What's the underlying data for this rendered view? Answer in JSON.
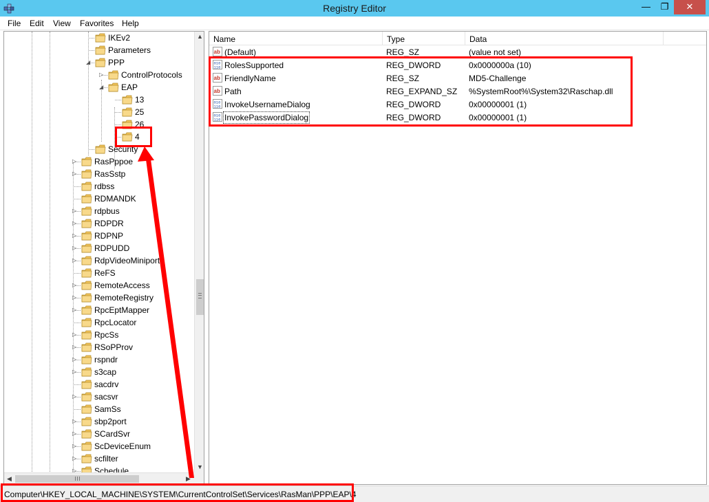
{
  "window": {
    "title": "Registry Editor",
    "minimize_glyph": "—",
    "restore_glyph": "❐",
    "close_glyph": "✕"
  },
  "menu": [
    "File",
    "Edit",
    "View",
    "Favorites",
    "Help"
  ],
  "tree": {
    "items": [
      {
        "label": "IKEv2",
        "expander": ""
      },
      {
        "label": "Parameters",
        "expander": ""
      },
      {
        "label": "PPP",
        "expander": "expanded"
      },
      {
        "label": "ControlProtocols",
        "expander": "collapsed"
      },
      {
        "label": "EAP",
        "expander": "expanded"
      },
      {
        "label": "13",
        "expander": ""
      },
      {
        "label": "25",
        "expander": ""
      },
      {
        "label": "26",
        "expander": ""
      },
      {
        "label": "4",
        "expander": "",
        "selected": true
      },
      {
        "label": "Security",
        "expander": ""
      },
      {
        "label": "RasPppoe",
        "expander": "collapsed"
      },
      {
        "label": "RasSstp",
        "expander": "collapsed"
      },
      {
        "label": "rdbss",
        "expander": ""
      },
      {
        "label": "RDMANDK",
        "expander": ""
      },
      {
        "label": "rdpbus",
        "expander": "collapsed"
      },
      {
        "label": "RDPDR",
        "expander": "collapsed"
      },
      {
        "label": "RDPNP",
        "expander": "collapsed"
      },
      {
        "label": "RDPUDD",
        "expander": "collapsed"
      },
      {
        "label": "RdpVideoMiniport",
        "expander": "collapsed"
      },
      {
        "label": "ReFS",
        "expander": ""
      },
      {
        "label": "RemoteAccess",
        "expander": "collapsed"
      },
      {
        "label": "RemoteRegistry",
        "expander": "collapsed"
      },
      {
        "label": "RpcEptMapper",
        "expander": "collapsed"
      },
      {
        "label": "RpcLocator",
        "expander": ""
      },
      {
        "label": "RpcSs",
        "expander": "collapsed"
      },
      {
        "label": "RSoPProv",
        "expander": "collapsed"
      },
      {
        "label": "rspndr",
        "expander": "collapsed"
      },
      {
        "label": "s3cap",
        "expander": "collapsed"
      },
      {
        "label": "sacdrv",
        "expander": ""
      },
      {
        "label": "sacsvr",
        "expander": "collapsed"
      },
      {
        "label": "SamSs",
        "expander": ""
      },
      {
        "label": "sbp2port",
        "expander": "collapsed"
      },
      {
        "label": "SCardSvr",
        "expander": "collapsed"
      },
      {
        "label": "ScDeviceEnum",
        "expander": "collapsed"
      },
      {
        "label": "scfilter",
        "expander": "collapsed"
      },
      {
        "label": "Schedule",
        "expander": "collapsed"
      }
    ]
  },
  "list": {
    "columns": [
      "Name",
      "Type",
      "Data"
    ],
    "rows": [
      {
        "name": "(Default)",
        "type": "REG_SZ",
        "data": "(value not set)",
        "icon": "string-value-icon"
      },
      {
        "name": "RolesSupported",
        "type": "REG_DWORD",
        "data": "0x0000000a (10)",
        "icon": "binary-value-icon"
      },
      {
        "name": "FriendlyName",
        "type": "REG_SZ",
        "data": "MD5-Challenge",
        "icon": "string-value-icon"
      },
      {
        "name": "Path",
        "type": "REG_EXPAND_SZ",
        "data": "%SystemRoot%\\System32\\Raschap.dll",
        "icon": "string-value-icon"
      },
      {
        "name": "InvokeUsernameDialog",
        "type": "REG_DWORD",
        "data": "0x00000001 (1)",
        "icon": "binary-value-icon"
      },
      {
        "name": "InvokePasswordDialog",
        "type": "REG_DWORD",
        "data": "0x00000001 (1)",
        "icon": "binary-value-icon"
      }
    ]
  },
  "statusbar": {
    "path": "Computer\\HKEY_LOCAL_MACHINE\\SYSTEM\\CurrentControlSet\\Services\\RasMan\\PPP\\EAP\\4"
  },
  "colors": {
    "titlebar": "#5ac8ef",
    "close_button": "#c7504b",
    "annotation": "#ff0000",
    "folder": "#f2c45a"
  }
}
